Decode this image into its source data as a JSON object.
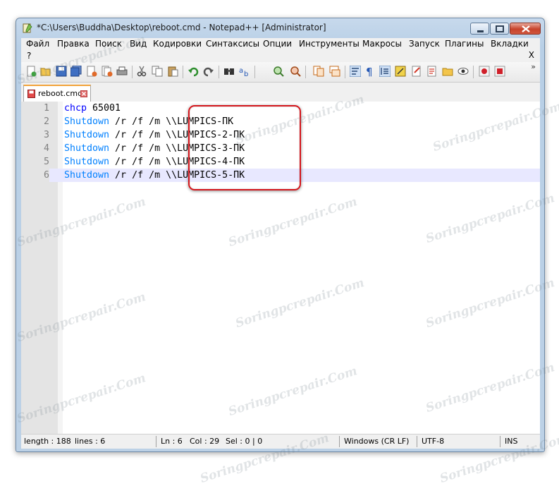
{
  "window": {
    "title": "*C:\\Users\\Buddha\\Desktop\\reboot.cmd - Notepad++ [Administrator]"
  },
  "menu": {
    "items": [
      "Файл",
      "Правка",
      "Поиск",
      "Вид",
      "Кодировки",
      "Синтаксисы",
      "Опции",
      "Инструменты",
      "Макросы",
      "Запуск",
      "Плагины",
      "Вкладки"
    ],
    "help": "?",
    "close": "X"
  },
  "toolbar": {
    "icons": [
      "new-file-icon",
      "open-file-icon",
      "save-icon",
      "save-all-icon",
      "close-icon",
      "close-all-icon",
      "print-icon",
      "cut-icon",
      "copy-icon",
      "paste-icon",
      "undo-icon",
      "redo-icon",
      "find-icon",
      "replace-icon",
      "zoom-in-icon",
      "zoom-out-icon",
      "sync-vertical-icon",
      "sync-horizontal-icon",
      "word-wrap-icon",
      "show-all-chars-icon",
      "indent-guide-icon",
      "user-lang-icon",
      "doc-map-icon",
      "function-list-icon",
      "folder-workspace-icon",
      "monitoring-icon",
      "record-macro-icon",
      "stop-record-icon"
    ],
    "more": "»"
  },
  "tab": {
    "label": "reboot.cmd"
  },
  "editor": {
    "lines": [
      {
        "num": "1",
        "cmd": "chcp",
        "rest": " 65001"
      },
      {
        "num": "2",
        "cmd": "Shutdown",
        "rest": " /r /f /m \\\\LUMPICS-ПК"
      },
      {
        "num": "3",
        "cmd": "Shutdown",
        "rest": " /r /f /m \\\\LUMPICS-2-ПК"
      },
      {
        "num": "4",
        "cmd": "Shutdown",
        "rest": " /r /f /m \\\\LUMPICS-3-ПК"
      },
      {
        "num": "5",
        "cmd": "Shutdown",
        "rest": " /r /f /m \\\\LUMPICS-4-ПК"
      },
      {
        "num": "6",
        "cmd": "Shutdown",
        "rest": " /r /f /m \\\\LUMPICS-5-ПК"
      }
    ],
    "current_line": 6
  },
  "status": {
    "length": "length : 188",
    "lines": "lines : 6",
    "ln": "Ln : 6",
    "col": "Col : 29",
    "sel": "Sel : 0 | 0",
    "eol": "Windows (CR LF)",
    "encoding": "UTF-8",
    "mode": "INS"
  },
  "watermark": "Soringpcrepair.Com",
  "colors": {
    "keyword_chcp": "#0000ff",
    "keyword_shutdown": "#0080ff",
    "number": "#ff8000",
    "highlight_box": "#d4161c",
    "current_line": "#e8e8ff"
  }
}
